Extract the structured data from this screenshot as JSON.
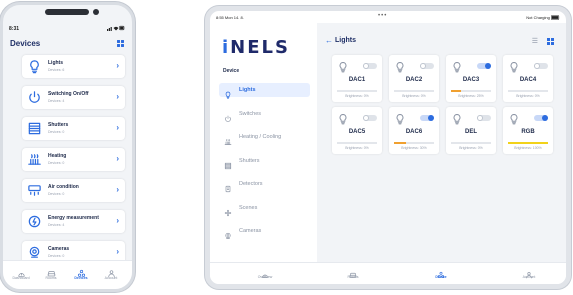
{
  "phone": {
    "time": "8:31",
    "status_icons": "wifi-signal-battery",
    "title": "Devices",
    "categories": [
      {
        "label": "Lights",
        "sub": "Devices: 6",
        "icon": "bulb-icon"
      },
      {
        "label": "Switching On/Off",
        "sub": "Devices: 4",
        "icon": "power-icon"
      },
      {
        "label": "Shutters",
        "sub": "Devices: 0",
        "icon": "shutters-icon"
      },
      {
        "label": "Heating",
        "sub": "Devices: 0",
        "icon": "heating-icon"
      },
      {
        "label": "Air condition",
        "sub": "Devices: 0",
        "icon": "air-condition-icon"
      },
      {
        "label": "Energy measurement",
        "sub": "Devices: 4",
        "icon": "energy-icon"
      },
      {
        "label": "Cameras",
        "sub": "Devices: 0",
        "icon": "camera-icon"
      }
    ],
    "tabs": [
      {
        "label": "Dashboard",
        "icon": "dashboard-icon",
        "active": false
      },
      {
        "label": "Rooms",
        "icon": "sofa-icon",
        "active": false
      },
      {
        "label": "Devices",
        "icon": "devices-icon",
        "active": true
      },
      {
        "label": "Account",
        "icon": "user-icon",
        "active": false
      }
    ]
  },
  "tablet": {
    "time": "8:55  Mon 14. 8.",
    "status": "Not Charging",
    "logo": {
      "accent": "i",
      "rest": "NELS"
    },
    "section": "Device",
    "sidebar": [
      {
        "label": "Lights",
        "icon": "bulb-icon",
        "active": true
      },
      {
        "label": "Switches",
        "icon": "power-icon",
        "active": false
      },
      {
        "label": "Heating / Cooling",
        "icon": "heating-icon",
        "active": false
      },
      {
        "label": "Shutters",
        "icon": "shutters-icon",
        "active": false
      },
      {
        "label": "Detectors",
        "icon": "detector-icon",
        "active": false
      },
      {
        "label": "Scenes",
        "icon": "scenes-icon",
        "active": false
      },
      {
        "label": "Cameras",
        "icon": "camera-icon",
        "active": false
      }
    ],
    "page_title": "Lights",
    "devices": [
      {
        "name": "DAC1",
        "brightness": "Brightness: 0%",
        "on": false,
        "level": 0,
        "color": "#e3e6eb"
      },
      {
        "name": "DAC2",
        "brightness": "Brightness: 0%",
        "on": false,
        "level": 0,
        "color": "#e3e6eb"
      },
      {
        "name": "DAC3",
        "brightness": "Brightness: 25%",
        "on": true,
        "level": 0.25,
        "color": "#f0a030"
      },
      {
        "name": "DAC4",
        "brightness": "Brightness: 0%",
        "on": false,
        "level": 0,
        "color": "#e3e6eb"
      },
      {
        "name": "DAC5",
        "brightness": "Brightness: 0%",
        "on": false,
        "level": 0,
        "color": "#e3e6eb"
      },
      {
        "name": "DAC6",
        "brightness": "Brightness: 30%",
        "on": true,
        "level": 0.3,
        "color": "#f0a030"
      },
      {
        "name": "DEL",
        "brightness": "Brightness: 0%",
        "on": false,
        "level": 0,
        "color": "#e3e6eb"
      },
      {
        "name": "RGB",
        "brightness": "Brightness: 100%",
        "on": true,
        "level": 1.0,
        "color": "#f2d21a"
      }
    ],
    "tabs": [
      {
        "label": "Overview",
        "icon": "dashboard-icon",
        "active": false
      },
      {
        "label": "Rooms",
        "icon": "sofa-icon",
        "active": false
      },
      {
        "label": "Device",
        "icon": "devices-icon",
        "active": true
      },
      {
        "label": "Account",
        "icon": "user-icon",
        "active": false
      }
    ]
  },
  "colors": {
    "accent": "#2d6cdf",
    "navy": "#1f2f66",
    "off_toggle": "#dfe3e9"
  }
}
